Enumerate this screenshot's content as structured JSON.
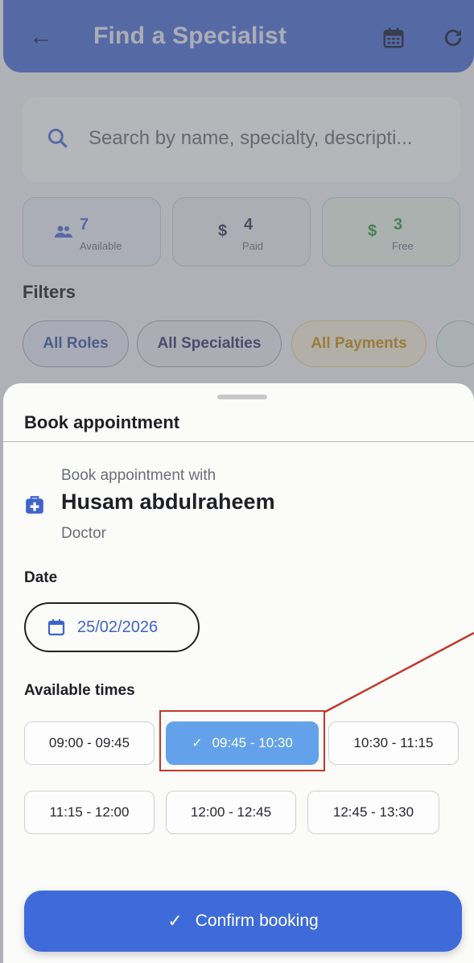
{
  "appbar": {
    "title": "Find a Specialist",
    "back_icon": "arrow-left-icon",
    "calendar_icon": "calendar-icon",
    "refresh_icon": "refresh-icon"
  },
  "search": {
    "placeholder": "Search by name, specialty, descripti..."
  },
  "stats": [
    {
      "value": "7",
      "label": "Available",
      "icon": "people-icon"
    },
    {
      "value": "4",
      "label": "Paid",
      "icon": "$"
    },
    {
      "value": "3",
      "label": "Free",
      "icon": "$"
    }
  ],
  "filters": {
    "label": "Filters",
    "chips": [
      "All Roles",
      "All Specialties",
      "All Payments"
    ]
  },
  "sheet": {
    "title": "Book appointment",
    "with_label": "Book appointment with",
    "doctor_name": "Husam abdulraheem",
    "doctor_role": "Doctor",
    "date_label": "Date",
    "date_value": "25/02/2026",
    "times_label": "Available times",
    "slots": [
      "09:00 - 09:45",
      "09:45 - 10:30",
      "10:30 - 11:15",
      "11:15 - 12:00",
      "12:00 - 12:45",
      "12:45 - 13:30"
    ],
    "selected_slot": "09:45 - 10:30",
    "confirm_label": "Confirm booking"
  },
  "colors": {
    "primary": "#3e6bd9",
    "selected_slot": "#63a2ea",
    "annotation": "#c0392b"
  }
}
